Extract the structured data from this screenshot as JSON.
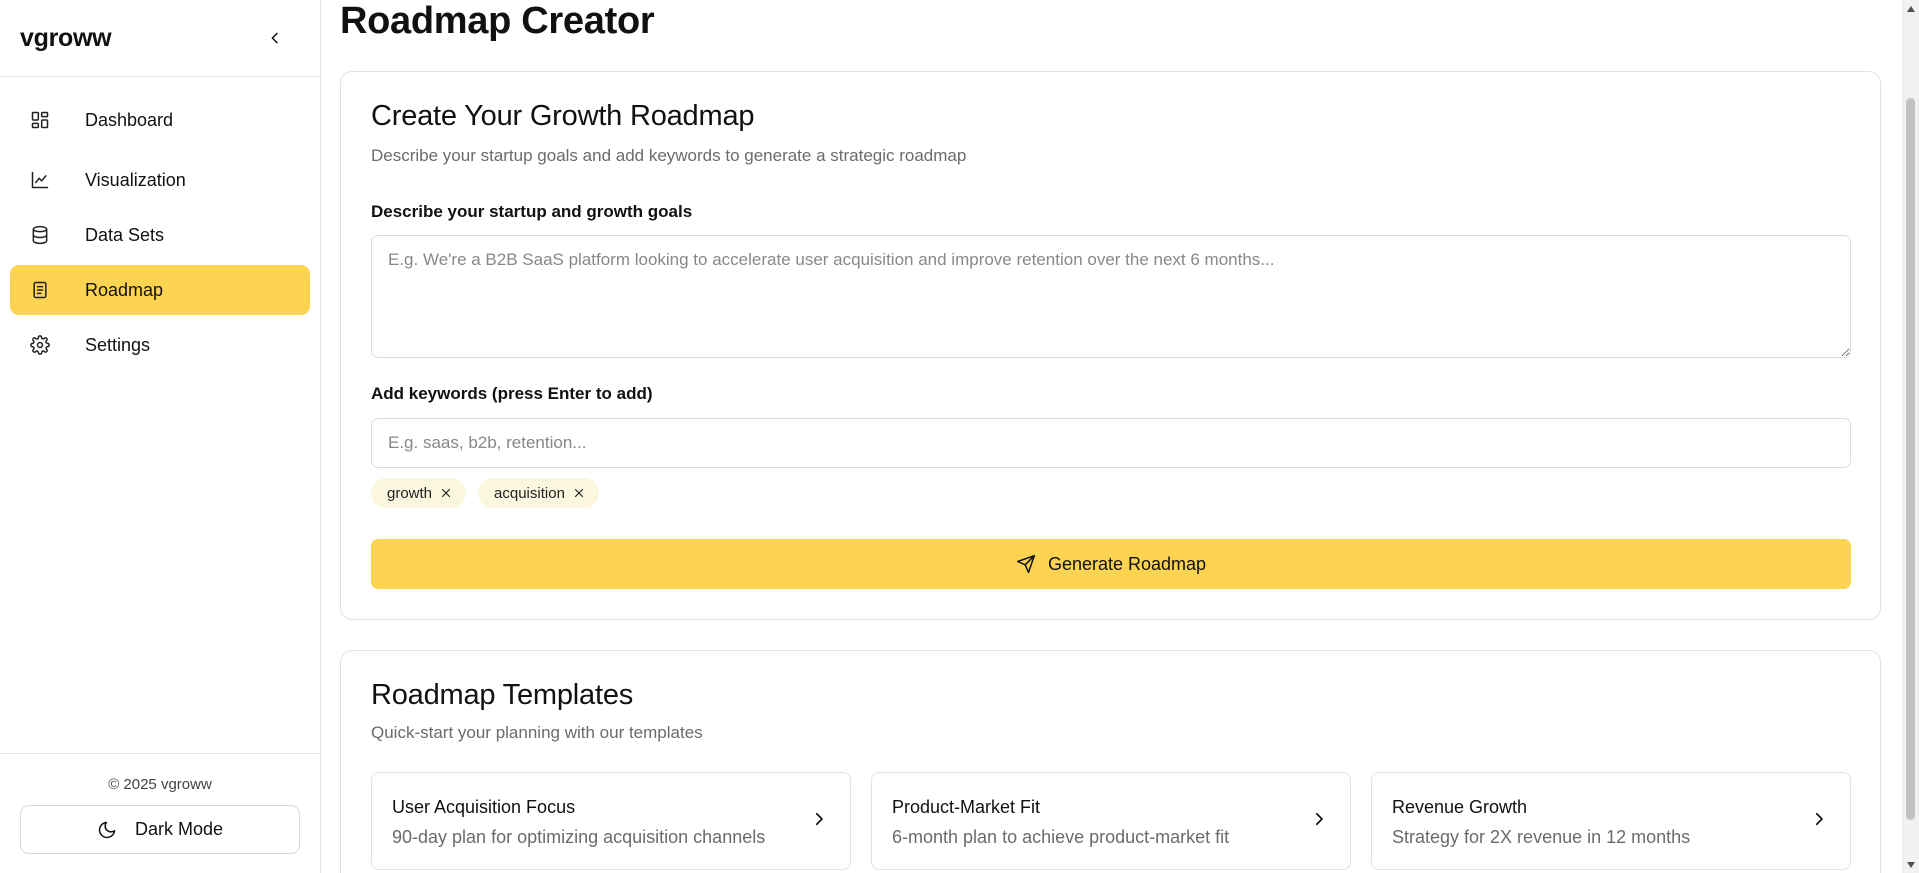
{
  "sidebar": {
    "brand": "vgroww",
    "items": [
      {
        "label": "Dashboard",
        "icon": "dashboard-icon"
      },
      {
        "label": "Visualization",
        "icon": "chart-line-icon"
      },
      {
        "label": "Data Sets",
        "icon": "database-icon"
      },
      {
        "label": "Roadmap",
        "icon": "document-icon",
        "active": true
      },
      {
        "label": "Settings",
        "icon": "gear-icon"
      }
    ],
    "copyright": "© 2025 vgroww",
    "dark_mode_label": "Dark Mode"
  },
  "main": {
    "page_title": "Roadmap Creator",
    "creator": {
      "title": "Create Your Growth Roadmap",
      "subtitle": "Describe your startup goals and add keywords to generate a strategic roadmap",
      "goals_label": "Describe your startup and growth goals",
      "goals_placeholder": "E.g. We're a B2B SaaS platform looking to accelerate user acquisition and improve retention over the next 6 months...",
      "keywords_label": "Add keywords (press Enter to add)",
      "keywords_placeholder": "E.g. saas, b2b, retention...",
      "tags": [
        "growth",
        "acquisition"
      ],
      "generate_label": "Generate Roadmap"
    },
    "templates": {
      "title": "Roadmap Templates",
      "subtitle": "Quick-start your planning with our templates",
      "items": [
        {
          "title": "User Acquisition Focus",
          "desc": "90-day plan for optimizing acquisition channels"
        },
        {
          "title": "Product-Market Fit",
          "desc": "6-month plan to achieve product-market fit"
        },
        {
          "title": "Revenue Growth",
          "desc": "Strategy for 2X revenue in 12 months"
        }
      ]
    }
  },
  "colors": {
    "accent": "#fdd352",
    "tag_bg": "#fbf7df",
    "muted_text": "#6b6b6b"
  }
}
